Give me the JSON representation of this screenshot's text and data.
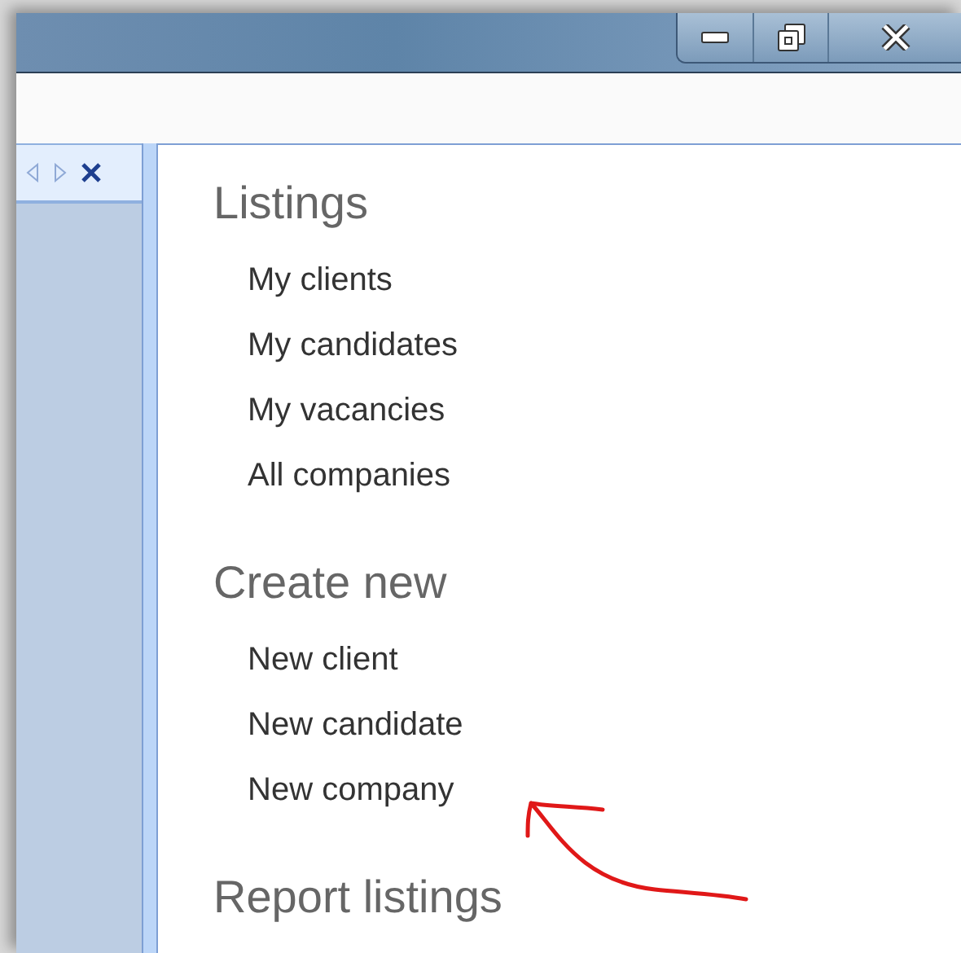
{
  "sections": [
    {
      "heading": "Listings",
      "items": [
        {
          "label": "My clients"
        },
        {
          "label": "My candidates"
        },
        {
          "label": "My vacancies"
        },
        {
          "label": "All companies"
        }
      ]
    },
    {
      "heading": "Create new",
      "items": [
        {
          "label": "New client"
        },
        {
          "label": "New candidate"
        },
        {
          "label": "New company"
        }
      ]
    },
    {
      "heading": "Report listings"
    }
  ]
}
